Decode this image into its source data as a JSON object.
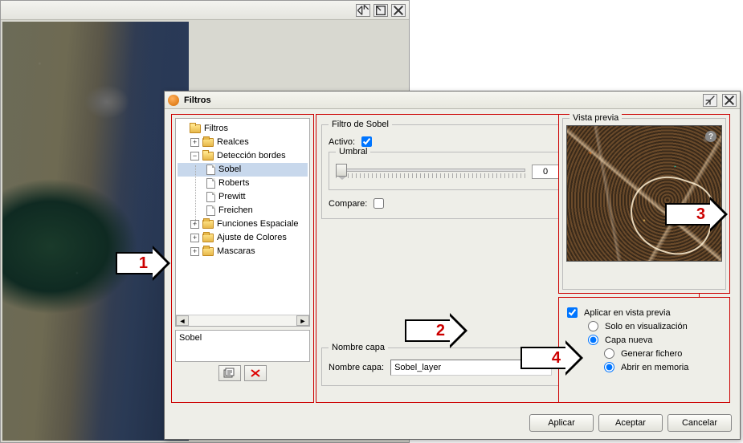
{
  "dialog": {
    "title": "Filtros",
    "tree": {
      "root": "Filtros",
      "realces": "Realces",
      "deteccion": "Detección bordes",
      "items": {
        "sobel": "Sobel",
        "roberts": "Roberts",
        "prewitt": "Prewitt",
        "freichen": "Freichen"
      },
      "funciones": "Funciones Espaciale",
      "ajuste": "Ajuste de Colores",
      "mascaras": "Mascaras"
    },
    "selected_name": "Sobel",
    "sobel_group": "Filtro de Sobel",
    "activo_label": "Activo:",
    "activo_checked": true,
    "umbral_group": "Umbral",
    "umbral_value": "0",
    "compare_label": "Compare:",
    "nombre_group": "Nombre capa",
    "nombre_label": "Nombre capa:",
    "nombre_value": "Sobel_layer",
    "preview_group": "Vista previa",
    "opts": {
      "aplicar": "Aplicar en vista previa",
      "solo": "Solo en visualización",
      "capa": "Capa nueva",
      "generar": "Generar fichero",
      "abrir": "Abrir en memoria"
    },
    "buttons": {
      "aplicar": "Aplicar",
      "aceptar": "Aceptar",
      "cancelar": "Cancelar"
    }
  },
  "annotations": {
    "a1": "1",
    "a2": "2",
    "a3": "3",
    "a4": "4"
  }
}
